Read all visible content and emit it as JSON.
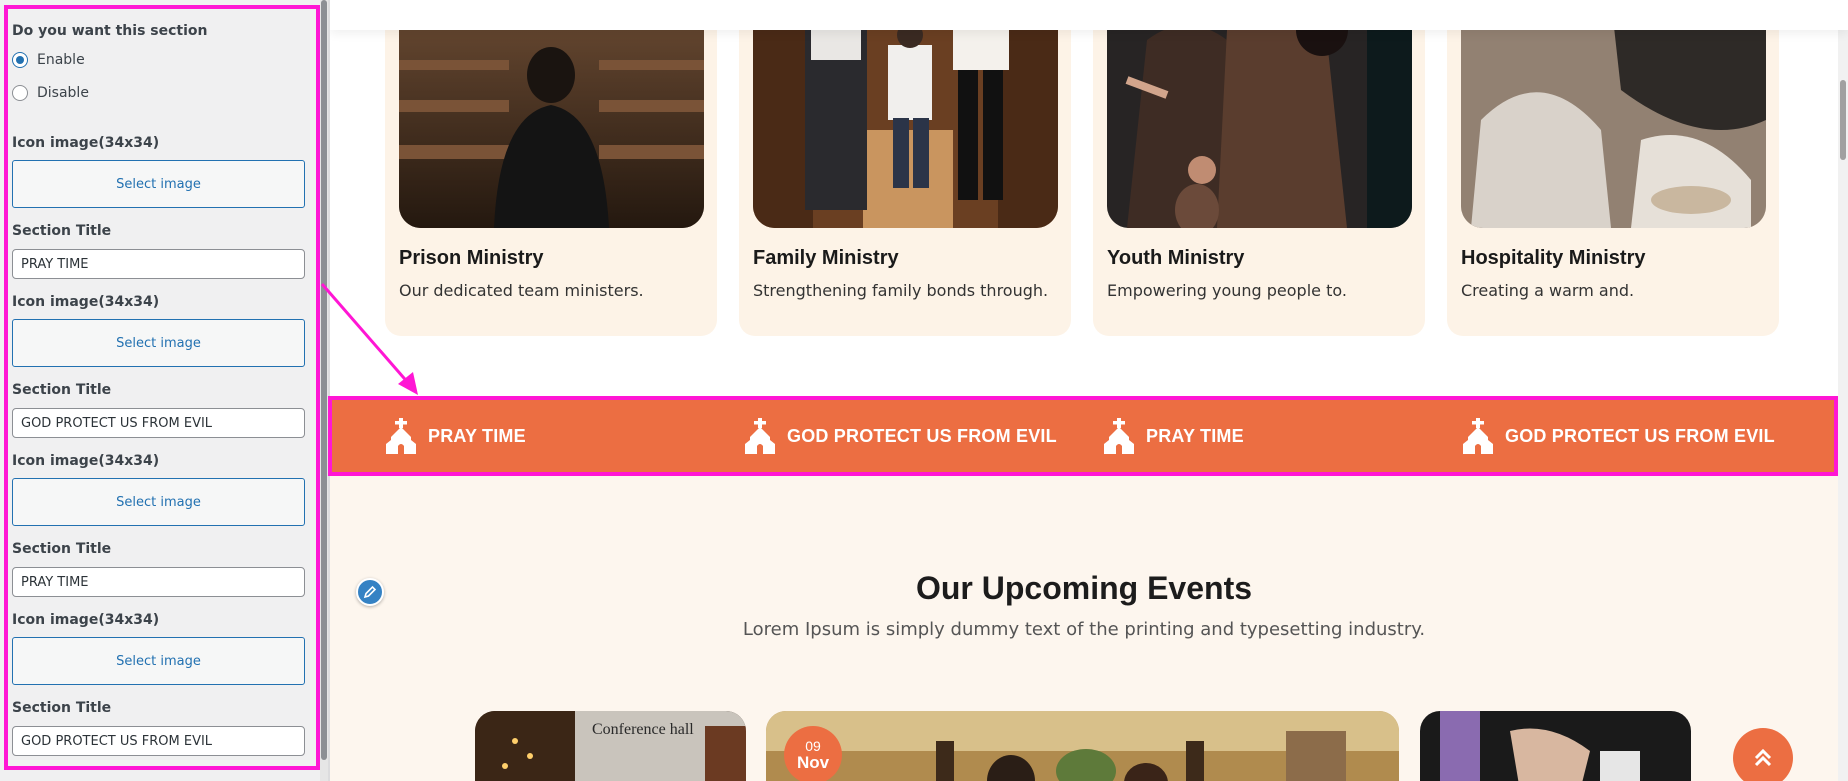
{
  "sidebar": {
    "toggle_label": "Do you want this section",
    "enable_label": "Enable",
    "disable_label": "Disable",
    "selected": "Enable",
    "fields": [
      {
        "icon_label": "Icon image(34x34)",
        "select_label": "Select image",
        "title_label": "Section Title",
        "title_value": "PRAY TIME"
      },
      {
        "icon_label": "Icon image(34x34)",
        "select_label": "Select image",
        "title_label": "Section Title",
        "title_value": "GOD PROTECT US FROM EVIL"
      },
      {
        "icon_label": "Icon image(34x34)",
        "select_label": "Select image",
        "title_label": "Section Title",
        "title_value": "PRAY TIME"
      },
      {
        "icon_label": "Icon image(34x34)",
        "select_label": "Select image",
        "title_label": "Section Title",
        "title_value": "GOD PROTECT US FROM EVIL"
      }
    ]
  },
  "ministries": [
    {
      "title": "Prison Ministry",
      "desc": "Our dedicated team ministers."
    },
    {
      "title": "Family Ministry",
      "desc": "Strengthening family bonds through."
    },
    {
      "title": "Youth Ministry",
      "desc": "Empowering young people to."
    },
    {
      "title": "Hospitality Ministry",
      "desc": "Creating a warm and."
    }
  ],
  "band": {
    "items": [
      "PRAY TIME",
      "GOD PROTECT US FROM EVIL",
      "PRAY TIME",
      "GOD PROTECT US FROM EVIL"
    ],
    "background": "#ec6e42",
    "icon": "church-icon"
  },
  "events": {
    "title": "Our Upcoming Events",
    "subtitle": "Lorem Ipsum is simply dummy text of the printing and typesetting industry.",
    "card_sign": "Conference hall",
    "badge_day": "09",
    "badge_month": "Nov"
  },
  "colors": {
    "accent": "#ec6e42",
    "highlight": "#ff16d4",
    "wp_blue": "#2271b1",
    "card_bg": "#fdf3e7"
  }
}
